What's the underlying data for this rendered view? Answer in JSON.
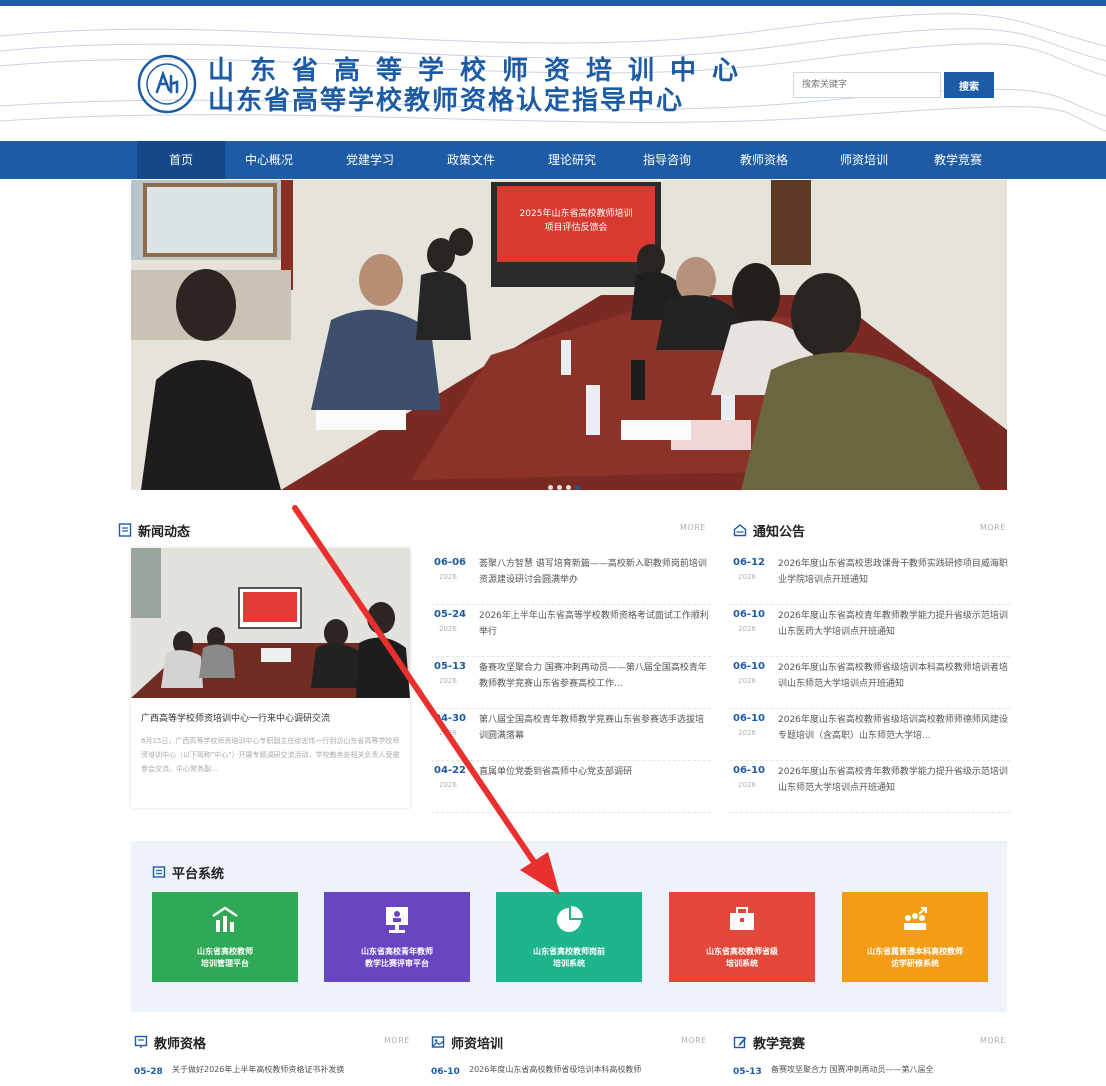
{
  "header": {
    "title_line1": "山东省高等学校师资培训中心",
    "title_line2": "山东省高等学校教师资格认定指导中心",
    "search_placeholder": "搜索关键字",
    "search_button": "搜索"
  },
  "nav": {
    "items": [
      {
        "label": "首页"
      },
      {
        "label": "中心概况"
      },
      {
        "label": "党建学习"
      },
      {
        "label": "政策文件"
      },
      {
        "label": "理论研究"
      },
      {
        "label": "指导咨询"
      },
      {
        "label": "教师资格"
      },
      {
        "label": "师资培训"
      },
      {
        "label": "教学竞赛"
      }
    ]
  },
  "banner": {
    "screen_title": "2025年山东省高校教师培训\n项目评估反馈会"
  },
  "news": {
    "title": "新闻动态",
    "more": "MORE",
    "feature_caption": "广西高等学校师资培训中心一行来中心调研交流",
    "feature_summary": "6月15日，广西高等学校师资培训中心专职副主任徐忠伟一行到访山东省高等学校师资培训中心（以下简称\"中心\"）开展专题调研交流活动，学校教务处相关负责人受邀参会交流。中心常务副...",
    "items": [
      {
        "md": "06-06",
        "year": "2026",
        "text": "荟聚八方智慧 谱写培育新篇——高校新入职教师岗前培训资源建设研讨会圆满举办"
      },
      {
        "md": "05-24",
        "year": "2026",
        "text": "2026年上半年山东省高等学校教师资格考试面试工作顺利举行"
      },
      {
        "md": "05-13",
        "year": "2026",
        "text": "备赛攻坚聚合力 国赛冲刺再动员——第八届全国高校青年教师教学竞赛山东省参赛高校工作..."
      },
      {
        "md": "04-30",
        "year": "2026",
        "text": "第八届全国高校青年教师教学竞赛山东省参赛选手选拔培训圆满落幕"
      },
      {
        "md": "04-22",
        "year": "2026",
        "text": "直属单位党委到省高师中心党支部调研"
      }
    ]
  },
  "notice": {
    "title": "通知公告",
    "more": "MORE",
    "items": [
      {
        "md": "06-12",
        "year": "2026",
        "text": "2026年度山东省高校思政课骨干教师实践研修项目威海职业学院培训点开班通知"
      },
      {
        "md": "06-10",
        "year": "2026",
        "text": "2026年度山东省高校青年教师教学能力提升省级示范培训山东医药大学培训点开班通知"
      },
      {
        "md": "06-10",
        "year": "2026",
        "text": "2026年度山东省高校教师省级培训本科高校教师培训者培训山东师范大学培训点开班通知"
      },
      {
        "md": "06-10",
        "year": "2026",
        "text": "2026年度山东省高校教师省级培训高校教师师德师风建设专题培训（含高职）山东师范大学培..."
      },
      {
        "md": "06-10",
        "year": "2026",
        "text": "2026年度山东省高校青年教师教学能力提升省级示范培训山东师范大学培训点开班通知"
      }
    ]
  },
  "platform": {
    "title": "平台系统",
    "tiles": [
      {
        "label": "山东省高校教师\n培训管理平台",
        "color": "#2fa955",
        "icon": "chart-icon"
      },
      {
        "label": "山东省高校青年教师\n教学比赛评审平台",
        "color": "#6a45c2",
        "icon": "presenter-icon"
      },
      {
        "label": "山东省高校教师岗前\n培训系统",
        "color": "#1db58c",
        "icon": "pie-icon"
      },
      {
        "label": "山东省高校教师省级\n培训系统",
        "color": "#e3473a",
        "icon": "briefcase-icon"
      },
      {
        "label": "山东省属普通本科高校教师\n访学研修系统",
        "color": "#f39c16",
        "icon": "people-icon"
      }
    ]
  },
  "bottom": {
    "qualification": {
      "title": "教师资格",
      "more": "MORE",
      "first": {
        "md": "05-28",
        "text": "关于做好2026年上半年高校教师资格证书补发换"
      }
    },
    "training": {
      "title": "师资培训",
      "more": "MORE",
      "first": {
        "md": "06-10",
        "text": "2026年度山东省高校教师省级培训本科高校教师"
      }
    },
    "competition": {
      "title": "教学竞赛",
      "more": "MORE",
      "first": {
        "md": "05-13",
        "text": "备赛攻坚聚合力 国赛冲刺再动员——第八届全"
      }
    }
  }
}
